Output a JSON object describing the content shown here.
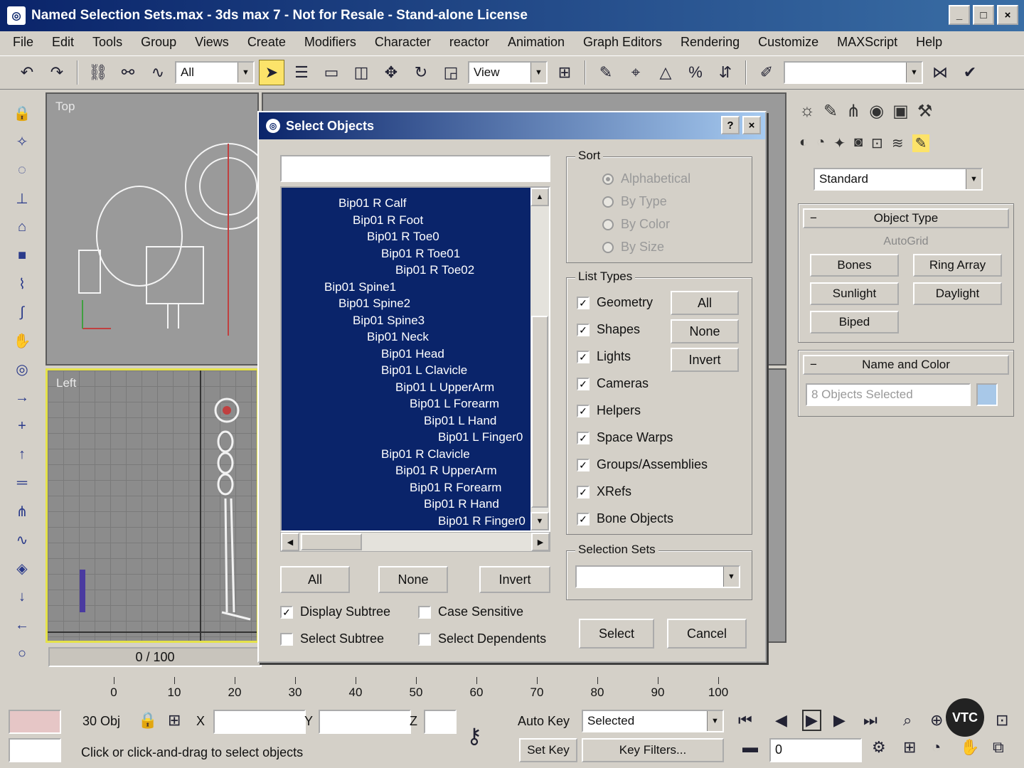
{
  "window": {
    "title": "Named Selection Sets.max - 3ds max 7 - Not for Resale - Stand-alone License",
    "controls": [
      "_",
      "□",
      "×"
    ]
  },
  "menu": [
    "File",
    "Edit",
    "Tools",
    "Group",
    "Views",
    "Create",
    "Modifiers",
    "Character",
    "reactor",
    "Animation",
    "Graph Editors",
    "Rendering",
    "Customize",
    "MAXScript",
    "Help"
  ],
  "toolbar": {
    "selection_filter": "All",
    "reference_coord": "View",
    "named_selection": ""
  },
  "viewports": {
    "top_label": "Top",
    "left_label": "Left"
  },
  "time_slider": {
    "label": "0 / 100"
  },
  "timeline": {
    "ticks": [
      "0",
      "10",
      "20",
      "30",
      "40",
      "50",
      "60",
      "70",
      "80",
      "90",
      "100"
    ]
  },
  "command_panel": {
    "category": "Standard",
    "object_type": {
      "title": "Object Type",
      "autogrid": "AutoGrid",
      "buttons": [
        "Bones",
        "Ring Array",
        "Sunlight",
        "Daylight",
        "Biped"
      ]
    },
    "name_color": {
      "title": "Name and Color",
      "value": "8 Objects Selected"
    }
  },
  "dialog": {
    "title": "Select Objects",
    "help": "?",
    "close": "×",
    "search_value": "",
    "items": [
      {
        "text": "Bip01 R Calf",
        "indent": 4
      },
      {
        "text": "Bip01 R Foot",
        "indent": 5
      },
      {
        "text": "Bip01 R Toe0",
        "indent": 6
      },
      {
        "text": "Bip01 R Toe01",
        "indent": 7
      },
      {
        "text": "Bip01 R Toe02",
        "indent": 8
      },
      {
        "text": "Bip01 Spine1",
        "indent": 3
      },
      {
        "text": "Bip01 Spine2",
        "indent": 4
      },
      {
        "text": "Bip01 Spine3",
        "indent": 5
      },
      {
        "text": "Bip01 Neck",
        "indent": 6
      },
      {
        "text": "Bip01 Head",
        "indent": 7
      },
      {
        "text": "Bip01 L Clavicle",
        "indent": 7
      },
      {
        "text": "Bip01 L UpperArm",
        "indent": 8
      },
      {
        "text": "Bip01 L Forearm",
        "indent": 9
      },
      {
        "text": "Bip01 L Hand",
        "indent": 10
      },
      {
        "text": "Bip01 L Finger0",
        "indent": 11
      },
      {
        "text": "Bip01 R Clavicle",
        "indent": 7
      },
      {
        "text": "Bip01 R UpperArm",
        "indent": 8
      },
      {
        "text": "Bip01 R Forearm",
        "indent": 9
      },
      {
        "text": "Bip01 R Hand",
        "indent": 10
      },
      {
        "text": "Bip01 R Finger0",
        "indent": 11
      }
    ],
    "list_buttons": [
      "All",
      "None",
      "Invert"
    ],
    "options": [
      {
        "label": "Display Subtree",
        "checked": true
      },
      {
        "label": "Case Sensitive",
        "checked": false
      },
      {
        "label": "Select Subtree",
        "checked": false
      },
      {
        "label": "Select Dependents",
        "checked": false
      }
    ],
    "sort": {
      "title": "Sort",
      "options": [
        "Alphabetical",
        "By Type",
        "By Color",
        "By Size"
      ],
      "selected": "Alphabetical"
    },
    "list_types": {
      "title": "List Types",
      "items": [
        "Geometry",
        "Shapes",
        "Lights",
        "Cameras",
        "Helpers",
        "Space Warps",
        "Groups/Assemblies",
        "XRefs",
        "Bone Objects"
      ],
      "buttons": [
        "All",
        "None",
        "Invert"
      ]
    },
    "selection_sets": {
      "title": "Selection Sets",
      "value": ""
    },
    "select_label": "Select",
    "cancel_label": "Cancel"
  },
  "status": {
    "selection": "30 Obj",
    "x_label": "X",
    "y_label": "Y",
    "z_label": "Z",
    "autokey": "Auto Key",
    "autokey_mode": "Selected",
    "setkey": "Set Key",
    "keyfilters": "Key Filters...",
    "frame": "0",
    "prompt": "Click or click-and-drag to select objects",
    "watermark": "VTC"
  },
  "colors": {
    "selection_blue": "#0a246a",
    "active_viewport": "#e5e24a",
    "status_swatch": "#e6c6c6"
  }
}
